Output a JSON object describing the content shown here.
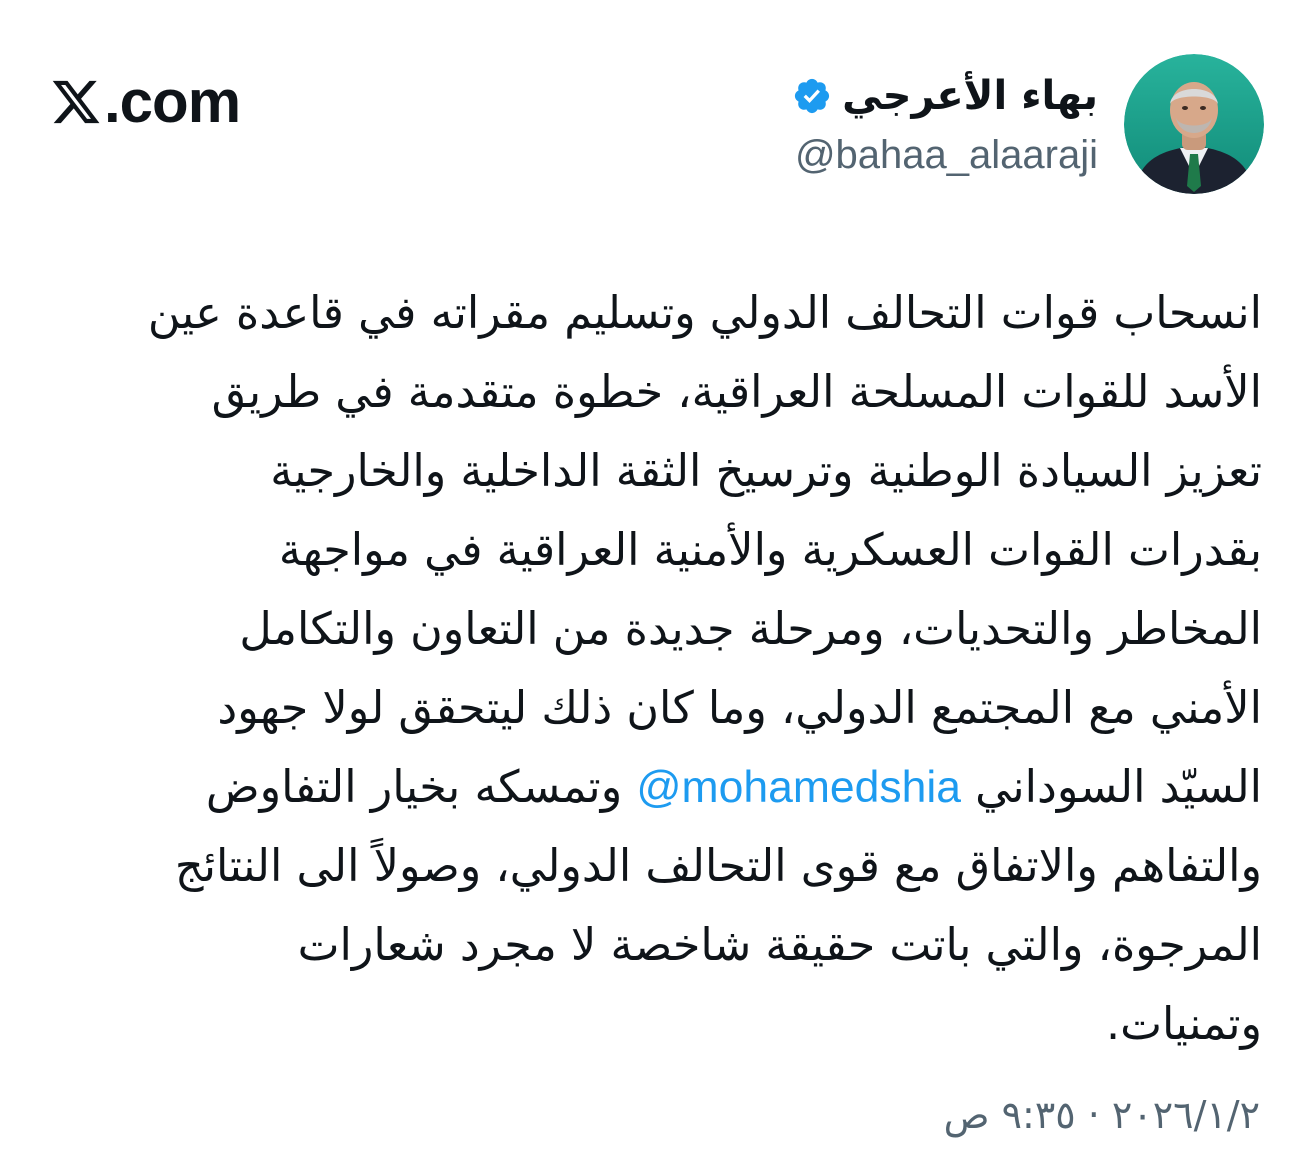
{
  "brand": {
    "text": ".com",
    "icon": "x-logo-icon"
  },
  "author": {
    "display_name": "بهاء الأعرجي",
    "handle": "@bahaa_alaaraji",
    "verified": true,
    "verified_color": "#1d9bf0",
    "avatar_bg": "#1aa08c"
  },
  "tweet": {
    "lines": [
      "انسحاب قوات التحالف الدولي وتسليم مقراته في قاعدة عين",
      "الأسد للقوات المسلحة العراقية، خطوة متقدمة في طريق",
      "تعزيز السيادة الوطنية وترسيخ الثقة الداخلية والخارجية",
      "بقدرات القوات العسكرية والأمنية العراقية في مواجهة",
      "المخاطر والتحديات، ومرحلة جديدة من التعاون والتكامل",
      "الأمني مع المجتمع الدولي، وما كان ذلك ليتحقق لولا جهود"
    ],
    "mention_line": {
      "before": "السيّد السوداني ",
      "mention": "@mohamedshia",
      "after": " وتمسكه بخيار التفاوض"
    },
    "lines_after": [
      "والتفاهم والاتفاق مع قوى التحالف الدولي، وصولاً الى النتائج",
      "المرجوة، والتي باتت حقيقة شاخصة لا مجرد شعارات",
      "وتمنيات."
    ],
    "mention_color": "#1d9bf0"
  },
  "timestamp": "٢٠٢٦/١/٢ · ٩:٣٥ ص"
}
